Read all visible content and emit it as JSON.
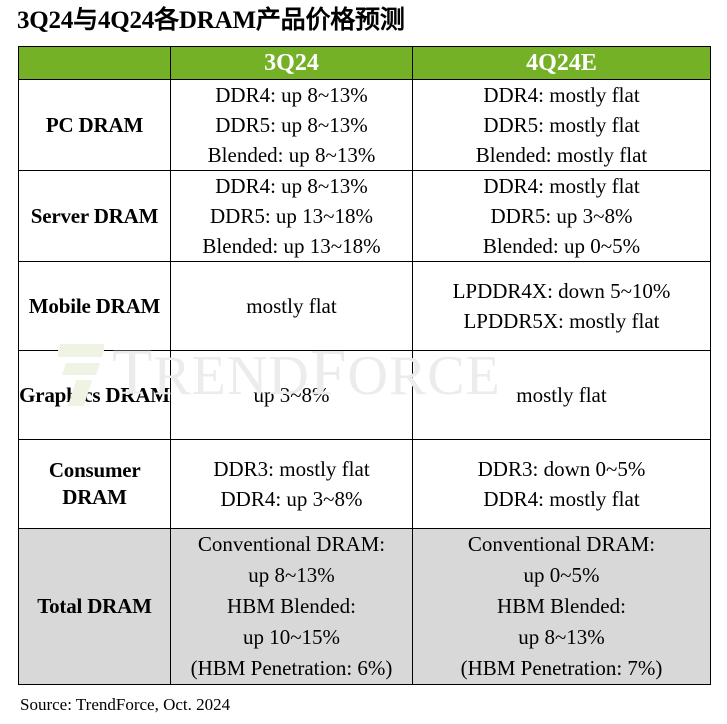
{
  "title": "3Q24与4Q24各DRAM产品价格预测",
  "watermark": {
    "text_part1": "T",
    "text_part2": "REND",
    "text_part3": "F",
    "text_part4": "ORCE",
    "full_text": "TRENDFORCE"
  },
  "colors": {
    "header_green": "#74b127",
    "total_row_gray": "#d8d8d8",
    "border": "#000000",
    "header_text": "#ffffff",
    "watermark_gray": "#ececed"
  },
  "table": {
    "columns": [
      "",
      "3Q24",
      "4Q24E"
    ],
    "rows": [
      {
        "label": "PC DRAM",
        "q3": [
          "DDR4: up 8~13%",
          "DDR5: up 8~13%",
          "Blended: up 8~13%"
        ],
        "q4": [
          "DDR4: mostly flat",
          "DDR5: mostly flat",
          "Blended: mostly flat"
        ]
      },
      {
        "label": "Server DRAM",
        "q3": [
          "DDR4: up 8~13%",
          "DDR5: up 13~18%",
          "Blended: up 13~18%"
        ],
        "q4": [
          "DDR4: mostly flat",
          "DDR5: up 3~8%",
          "Blended: up 0~5%"
        ]
      },
      {
        "label": "Mobile\nDRAM",
        "label_line1": "Mobile",
        "label_line2": "DRAM",
        "q3": [
          "mostly flat"
        ],
        "q4": [
          "LPDDR4X: down 5~10%",
          "LPDDR5X: mostly flat"
        ]
      },
      {
        "label": "Graphics\nDRAM",
        "label_line1": "Graphics",
        "label_line2": "DRAM",
        "q3": [
          "up 3~8%"
        ],
        "q4": [
          "mostly flat"
        ]
      },
      {
        "label": "Consumer\nDRAM",
        "label_line1": "Consumer",
        "label_line2": "DRAM",
        "q3": [
          "DDR3: mostly flat",
          "DDR4: up 3~8%"
        ],
        "q4": [
          "DDR3: down 0~5%",
          "DDR4: mostly flat"
        ]
      },
      {
        "label": "Total DRAM",
        "q3": [
          "Conventional DRAM:",
          "up 8~13%",
          "HBM Blended:",
          "up 10~15%",
          "(HBM Penetration: 6%)"
        ],
        "q4": [
          "Conventional DRAM:",
          "up 0~5%",
          "HBM Blended:",
          "up 8~13%",
          "(HBM Penetration: 7%)"
        ]
      }
    ]
  },
  "source": "Source: TrendForce, Oct. 2024"
}
